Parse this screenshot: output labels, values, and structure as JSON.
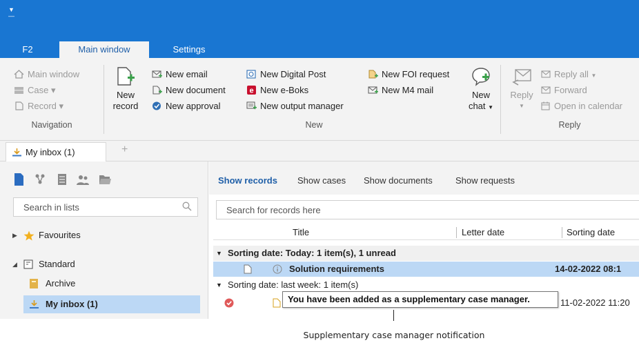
{
  "ribbon_tabs": {
    "f2": "F2",
    "main": "Main window",
    "settings": "Settings"
  },
  "navigation": {
    "items": [
      "Main window",
      "Case ▾",
      "Record ▾"
    ],
    "label": "Navigation"
  },
  "new_group": {
    "new_record": [
      "New",
      "record"
    ],
    "col1": [
      "New email",
      "New document",
      "New approval"
    ],
    "col2": [
      "New Digital Post",
      "New e-Boks",
      "New output manager"
    ],
    "col3": [
      "New FOI request",
      "New M4 mail"
    ],
    "new_chat": [
      "New",
      "chat"
    ],
    "label": "New"
  },
  "reply_group": {
    "reply": "Reply",
    "items": [
      "Reply all",
      "Forward",
      "Open in calendar"
    ],
    "label": "Reply"
  },
  "doc_tab": {
    "label": "My inbox (1)",
    "plus": "+"
  },
  "left": {
    "search_placeholder": "Search in lists",
    "favourites": "Favourites",
    "standard": "Standard",
    "archive": "Archive",
    "inbox": "My inbox (1)"
  },
  "right": {
    "tabs": [
      "Show records",
      "Show cases",
      "Show documents",
      "Show requests"
    ],
    "search_placeholder": "Search for records here",
    "columns": {
      "title": "Title",
      "letter_date": "Letter date",
      "sorting_date": "Sorting date"
    },
    "group1": "Sorting date: Today: 1 item(s), 1 unread",
    "record1": {
      "title": "Solution requirements",
      "date": "14-02-2022 08:1"
    },
    "group2": "Sorting date: last week: 1 item(s)",
    "record2": {
      "date": "11-02-2022 11:20"
    }
  },
  "tooltip": "You have been added as a supplementary case manager.",
  "caption": "Supplementary case manager notification",
  "colors": {
    "accent": "#1976d2",
    "selection": "#bcd8f5",
    "link": "#1f5fa8"
  }
}
